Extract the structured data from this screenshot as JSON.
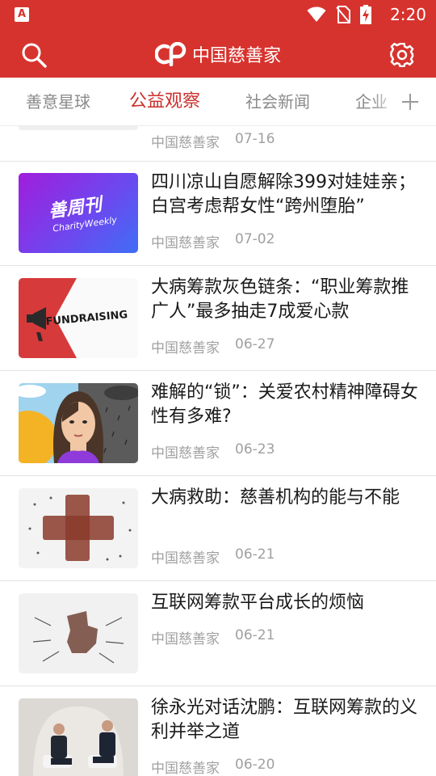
{
  "status_bar": {
    "time": "2:20",
    "icons": [
      "app-notification-icon",
      "wifi-icon",
      "no-sim-icon",
      "battery-charging-icon"
    ]
  },
  "app_bar": {
    "logo_mark": "cp",
    "logo_text": "中国慈善家",
    "left_icon": "search-icon",
    "right_icon": "settings-gear-icon"
  },
  "tabs": {
    "items": [
      {
        "label": "善意星球",
        "active": false
      },
      {
        "label": "公益观察",
        "active": true
      },
      {
        "label": "社会新闻",
        "active": false
      },
      {
        "label": "企业",
        "active": false
      }
    ],
    "add_icon": "plus-icon",
    "active_color": "#c9302c"
  },
  "feed": {
    "partial_item": {
      "source": "中国慈善家",
      "date": "07-16"
    },
    "items": [
      {
        "title": "四川凉山自愿解除399对娃娃亲；白宫考虑帮女性“跨州堕胎”",
        "source": "中国慈善家",
        "date": "07-02",
        "thumb_text": "善周刊",
        "thumb_subtext": "CharityWeekly"
      },
      {
        "title": "大病筹款灰色链条：“职业筹款推广人”最多抽走7成爱心款",
        "source": "中国慈善家",
        "date": "06-27",
        "thumb_text": "FUNDRAISING"
      },
      {
        "title": "难解的“锁”：关爱农村精神障碍女性有多难?",
        "source": "中国慈善家",
        "date": "06-23"
      },
      {
        "title": "大病救助：慈善机构的能与不能",
        "source": "中国慈善家",
        "date": "06-21"
      },
      {
        "title": "互联网筹款平台成长的烦恼",
        "source": "中国慈善家",
        "date": "06-21"
      },
      {
        "title": "徐永光对话沈鹏：互联网筹款的义利并举之道",
        "source": "中国慈善家",
        "date": "06-20"
      }
    ]
  },
  "colors": {
    "brand_red": "#d7332e",
    "meta_gray": "#a0a0a0",
    "title_black": "#1a1a1a"
  }
}
